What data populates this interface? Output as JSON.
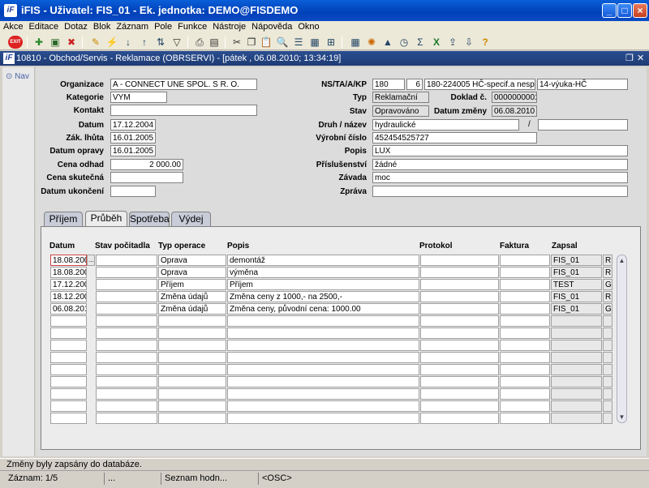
{
  "window": {
    "title": "iFIS - Uživatel: FIS_01 - Ek. jednotka: DEMO@FISDEMO",
    "icon_text": "iF"
  },
  "menu": [
    "Akce",
    "Editace",
    "Dotaz",
    "Blok",
    "Záznam",
    "Pole",
    "Funkce",
    "Nástroje",
    "Nápověda",
    "Okno"
  ],
  "toolbar": {
    "exit_label": "EXIT"
  },
  "form": {
    "title": "10810 - Obchod/Servis - Reklamace (OBRSERVI) - [pátek  , 06.08.2010; 13:34:19]"
  },
  "nav": {
    "label": "Nav"
  },
  "fields": {
    "organizace_label": "Organizace",
    "organizace": "A - CONNECT UNE SPOL. S R. O.",
    "kategorie_label": "Kategorie",
    "kategorie": "VYM",
    "kontakt_label": "Kontakt",
    "kontakt": "",
    "datum_label": "Datum",
    "datum": "17.12.2004",
    "zak_lhuta_label": "Zák. lhůta",
    "zak_lhuta": "16.01.2005",
    "datum_opravy_label": "Datum opravy",
    "datum_opravy": "16.01.2005",
    "cena_odhad_label": "Cena odhad",
    "cena_odhad": "2 000.00",
    "cena_skutecna_label": "Cena skutečná",
    "cena_skutecna": "",
    "datum_ukonceni_label": "Datum ukončení",
    "datum_ukonceni": "",
    "ns_label": "NS/TA/A/KP",
    "ns": "180",
    "ta": "6",
    "a": "180-224005 HČ-specif.a nesp.vý",
    "kp": "14-výuka-HČ",
    "typ_label": "Typ",
    "typ": "Reklamační",
    "doklad_label": "Doklad č.",
    "doklad": "0000000001",
    "stav_label": "Stav",
    "stav": "Opravováno",
    "datum_zmeny_label": "Datum změny",
    "datum_zmeny": "06.08.2010",
    "druh_label": "Druh / název",
    "druh": "hydraulické",
    "druh_slash": "/",
    "nazev": "",
    "vyrobni_label": "Výrobní číslo",
    "vyrobni": "452454525727",
    "popis_label": "Popis",
    "popis": "LUX",
    "prislusenstvi_label": "Příslušenství",
    "prislusenstvi": "žádné",
    "zavada_label": "Závada",
    "zavada": "moc",
    "zprava_label": "Zpráva",
    "zprava": ""
  },
  "tabs": [
    "Příjem",
    "Průběh",
    "Spotřeba",
    "Výdej"
  ],
  "table": {
    "headers": [
      "Datum",
      "Stav počitadla",
      "Typ operace",
      "Popis",
      "Protokol",
      "Faktura",
      "Zapsal"
    ],
    "rows": [
      [
        "18.08.2004",
        "",
        "Oprava",
        "demontáž",
        "",
        "",
        "FIS_01",
        "R"
      ],
      [
        "18.08.2004",
        "",
        "Oprava",
        "výměna",
        "",
        "",
        "FIS_01",
        "R"
      ],
      [
        "17.12.2004",
        "",
        "Příjem",
        "Příjem",
        "",
        "",
        "TEST",
        "G"
      ],
      [
        "18.12.2004",
        "",
        "Změna údajů",
        "Změna ceny z 1000,- na 2500,-",
        "",
        "",
        "FIS_01",
        "R"
      ],
      [
        "06.08.2010",
        "",
        "Změna údajů",
        "Změna ceny, původní cena: 1000.00",
        "",
        "",
        "FIS_01",
        "G"
      ]
    ],
    "empty_rows": 9,
    "lov_button": "..."
  },
  "status": {
    "message": "Změny byly zapsány do databáze.",
    "record": "Záznam: 1/5",
    "dots": "...",
    "list": "Seznam hodn...",
    "osc": "<OSC>"
  }
}
